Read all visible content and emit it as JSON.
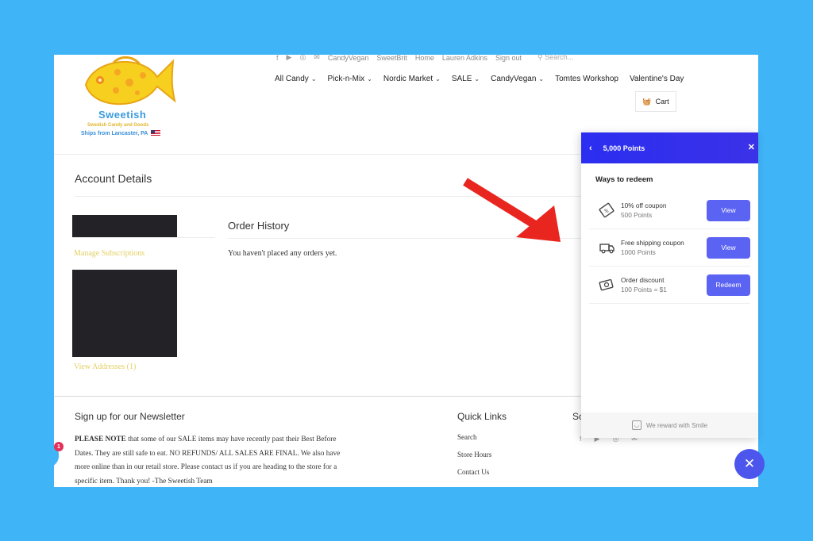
{
  "brand": {
    "name": "Sweetish",
    "tagline": "Swedish Candy and Goods",
    "ships": "Ships from Lancaster, PA"
  },
  "topbar": {
    "links": [
      "CandyVegan",
      "SweetBrit",
      "Home",
      "Lauren Adkins",
      "Sign out"
    ],
    "search_placeholder": "Search..."
  },
  "nav": {
    "items": [
      {
        "label": "All Candy",
        "has_dropdown": true
      },
      {
        "label": "Pick-n-Mix",
        "has_dropdown": true
      },
      {
        "label": "Nordic Market",
        "has_dropdown": true
      },
      {
        "label": "SALE",
        "has_dropdown": true
      },
      {
        "label": "CandyVegan",
        "has_dropdown": true
      },
      {
        "label": "Tomtes Workshop",
        "has_dropdown": false
      },
      {
        "label": "Valentine's Day",
        "has_dropdown": false
      }
    ],
    "cart_label": "Cart"
  },
  "account": {
    "title": "Account Details",
    "manage_subscriptions": "Manage Subscriptions",
    "view_addresses": "View Addresses (1)"
  },
  "orders": {
    "title": "Order History",
    "empty_text": "You haven't placed any orders yet."
  },
  "footer": {
    "newsletter_title": "Sign up for our Newsletter",
    "notice_bold": "PLEASE NOTE",
    "notice_text": " that some of our SALE items may have recently past their Best Before Dates. They are still safe to eat. NO REFUNDS/ ALL SALES ARE FINAL. We also have more online than in our retail store. Please contact us if you are heading to the store for a specific item. Thank you! -The Sweetish Team",
    "quick_links_title": "Quick Links",
    "quick_links": [
      "Search",
      "Store Hours",
      "Contact Us"
    ],
    "social_title": "Social",
    "chat_badge": "1"
  },
  "rewards_panel": {
    "points_title": "5,000 Points",
    "section_title": "Ways to redeem",
    "items": [
      {
        "name": "10% off coupon",
        "points": "500 Points",
        "button": "View",
        "icon": "coupon-icon"
      },
      {
        "name": "Free shipping coupon",
        "points": "1000 Points",
        "button": "View",
        "icon": "truck-icon"
      },
      {
        "name": "Order discount",
        "points": "100 Points = $1",
        "button": "Redeem",
        "icon": "cash-icon"
      }
    ],
    "footer_text": "We reward with Smile"
  },
  "colors": {
    "background": "#3fb4f7",
    "panel_header": "#2b2ef0",
    "button": "#5b63f2",
    "link_gold": "#e4cf62",
    "arrow": "#e8261f"
  }
}
